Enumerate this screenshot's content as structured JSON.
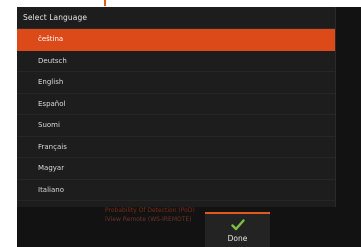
{
  "dialog": {
    "title": "Select Language",
    "languages": [
      {
        "label": "čeština",
        "selected": true
      },
      {
        "label": "Deutsch",
        "selected": false
      },
      {
        "label": "English",
        "selected": false
      },
      {
        "label": "Español",
        "selected": false
      },
      {
        "label": "Suomi",
        "selected": false
      },
      {
        "label": "Français",
        "selected": false
      },
      {
        "label": "Magyar",
        "selected": false
      },
      {
        "label": "Italiano",
        "selected": false
      }
    ]
  },
  "background": {
    "line1": "Probability Of Detection (PoD)",
    "line2": "iView Remote (WS-IREMOTE)"
  },
  "done_button": {
    "label": "Done",
    "icon": "checkmark-icon"
  },
  "colors": {
    "accent": "#dd4a1a",
    "check": "#7bc043",
    "dialog_bg": "#1d1d1d",
    "screen_bg": "#121212"
  }
}
